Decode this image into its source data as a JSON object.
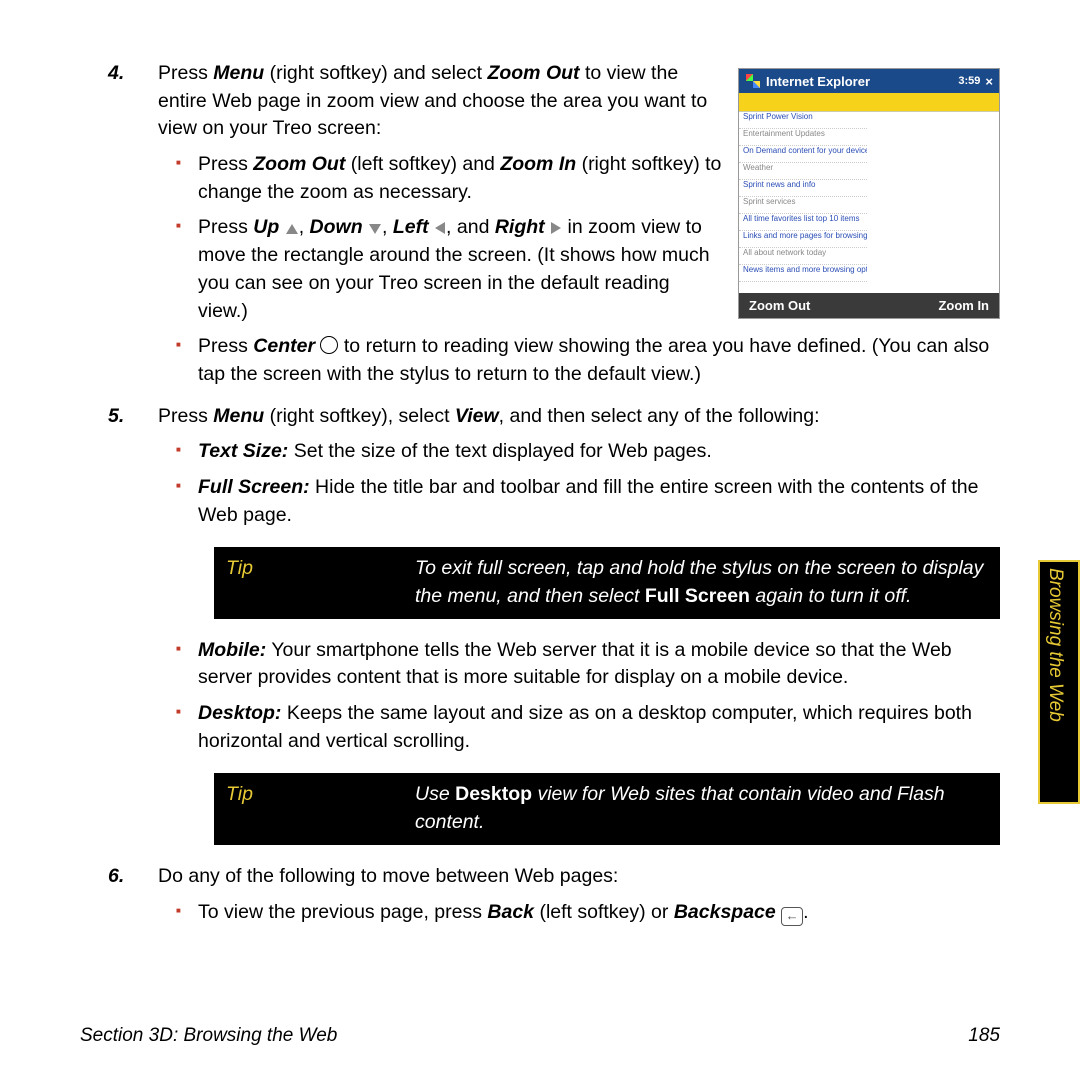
{
  "side_tab": "Browsing the Web",
  "footer": {
    "section": "Section 3D: Browsing the Web",
    "page": "185"
  },
  "screenshot": {
    "title": "Internet Explorer",
    "time": "3:59",
    "foot_left": "Zoom Out",
    "foot_right": "Zoom In"
  },
  "steps": {
    "s4": {
      "num": "4.",
      "text_a": "Press ",
      "menu": "Menu",
      "text_b": " (right softkey) and select ",
      "zoomout": "Zoom Out",
      "text_c": " to view the entire Web page in zoom view and choose the area you want to view on your Treo screen:",
      "sub1_a": "Press ",
      "sub1_zo": "Zoom Out",
      "sub1_b": " (left softkey) and ",
      "sub1_zi": "Zoom In",
      "sub1_c": " (right softkey) to change the zoom as necessary.",
      "sub2_a": "Press ",
      "sub2_up": "Up",
      "sub2_down": "Down",
      "sub2_left": "Left",
      "sub2_right": "Right",
      "sub2_b": " in zoom view to move the rectangle around the screen. (It shows how much you can see on your Treo screen in the default reading view.)",
      "sub3_a": "Press ",
      "sub3_center": "Center",
      "sub3_b": " to return to reading view showing the area you have defined. (You can also tap the screen with the stylus to return to the default view.)"
    },
    "s5": {
      "num": "5.",
      "text_a": "Press ",
      "menu": "Menu",
      "text_b": " (right softkey), select ",
      "view": "View",
      "text_c": ", and then select any of the following:",
      "ts_label": "Text Size:",
      "ts_text": " Set the size of the text displayed for Web pages.",
      "fs_label": "Full Screen:",
      "fs_text": " Hide the title bar and toolbar and fill the entire screen with the contents of the Web page.",
      "mb_label": "Mobile:",
      "mb_text": " Your smartphone tells the Web server that it is a mobile device so that the Web server provides content that is more suitable for display on a mobile device.",
      "dk_label": "Desktop:",
      "dk_text": " Keeps the same layout and size as on a desktop computer, which requires both horizontal and vertical scrolling."
    },
    "s6": {
      "num": "6.",
      "text": "Do any of the following to move between Web pages:",
      "sub1_a": "To view the previous page, press ",
      "sub1_back": "Back",
      "sub1_b": " (left softkey) or ",
      "sub1_bksp": "Backspace",
      "sub1_c": "."
    }
  },
  "tips": {
    "label": "Tip",
    "t1_a": "To exit full screen, tap and hold the stylus on the screen to display the menu, and then select ",
    "t1_fs": "Full Screen",
    "t1_b": " again to turn it off.",
    "t2_a": "Use ",
    "t2_dk": "Desktop",
    "t2_b": " view for Web sites that contain video and Flash content."
  }
}
